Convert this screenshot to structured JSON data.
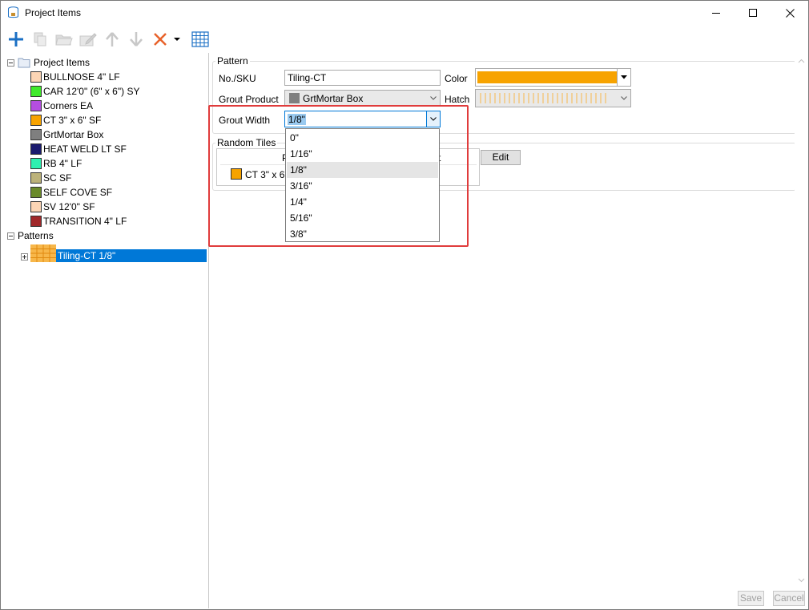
{
  "window": {
    "title": "Project Items"
  },
  "colors": {
    "accent": "#0078d7",
    "highlight": "#e03c3c",
    "tile_orange": "#f7a300"
  },
  "toolbar": {
    "buttons": [
      {
        "icon": "plus-icon",
        "enabled": true
      },
      {
        "icon": "copy-icon",
        "enabled": false
      },
      {
        "icon": "folder-open-icon",
        "enabled": false
      },
      {
        "icon": "edit-icon",
        "enabled": false
      },
      {
        "icon": "arrow-up-icon",
        "enabled": false
      },
      {
        "icon": "arrow-down-icon",
        "enabled": false
      },
      {
        "icon": "delete-x-icon",
        "enabled": true
      },
      {
        "icon": "dropdown-caret-icon",
        "enabled": true
      },
      {
        "icon": "grid-icon",
        "enabled": true
      }
    ]
  },
  "tree": {
    "root_label": "Project Items",
    "items": [
      {
        "label": "BULLNOSE 4\" LF",
        "color": "#fbd5b5"
      },
      {
        "label": "CAR 12'0\" (6\" x 6\") SY",
        "color": "#3fea2b"
      },
      {
        "label": "Corners  EA",
        "color": "#b44ee0"
      },
      {
        "label": "CT 3\" x 6\" SF",
        "color": "#f7a300"
      },
      {
        "label": "GrtMortar Box",
        "color": "#7f7f7f"
      },
      {
        "label": "HEAT WELD LT  SF",
        "color": "#1a1a6e"
      },
      {
        "label": "RB 4\" LF",
        "color": "#2ef0b0"
      },
      {
        "label": "SC  SF",
        "color": "#bcb27a"
      },
      {
        "label": "SELF COVE  SF",
        "color": "#6a8a2a"
      },
      {
        "label": "SV 12'0\" SF",
        "color": "#fbd5b5"
      },
      {
        "label": "TRANSITION 4\" LF",
        "color": "#a0282a"
      }
    ],
    "patterns_label": "Patterns",
    "pattern_item": "Tiling-CT 1/8\""
  },
  "pattern_form": {
    "group_title": "Pattern",
    "sku_label": "No./SKU",
    "sku_value": "Tiling-CT",
    "color_label": "Color",
    "grout_product_label": "Grout Product",
    "grout_product_value": "GrtMortar Box",
    "hatch_label": "Hatch",
    "grout_width_label": "Grout Width",
    "grout_width_value": "1/8\"",
    "random_tiles_title": "Random Tiles",
    "random_tile_item": "CT 3\" x 6\"",
    "edit_label": "Edit",
    "header_partial_left": "P",
    "header_partial_right": "t"
  },
  "dropdown": {
    "options": [
      "0\"",
      "1/16\"",
      "1/8\"",
      "3/16\"",
      "1/4\"",
      "5/16\"",
      "3/8\""
    ],
    "hovered_index": 2
  },
  "footer": {
    "save_label": "Save",
    "cancel_label": "Cancel"
  }
}
